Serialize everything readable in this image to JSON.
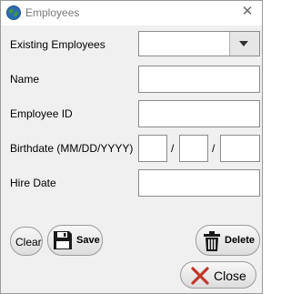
{
  "window": {
    "title": "Employees",
    "icon": "globe-icon",
    "close_icon": "close-icon"
  },
  "form": {
    "existing_label": "Existing Employees",
    "existing_value": "",
    "name_label": "Name",
    "name_value": "",
    "employee_id_label": "Employee ID",
    "employee_id_value": "",
    "birthdate_label": "Birthdate (MM/DD/YYYY)",
    "birth_month": "",
    "birth_day": "",
    "birth_year": "",
    "date_separator": "/",
    "hire_date_label": "Hire Date",
    "hire_date_value": ""
  },
  "buttons": {
    "clear": "Clear",
    "save": "Save",
    "delete": "Delete",
    "close": "Close"
  },
  "icons": {
    "save": "floppy-disk-icon",
    "delete": "trash-can-icon",
    "close": "red-x-icon",
    "dropdown": "chevron-down-icon"
  },
  "colors": {
    "close_x": "#c0392b",
    "field_border": "#8c8c8c"
  }
}
